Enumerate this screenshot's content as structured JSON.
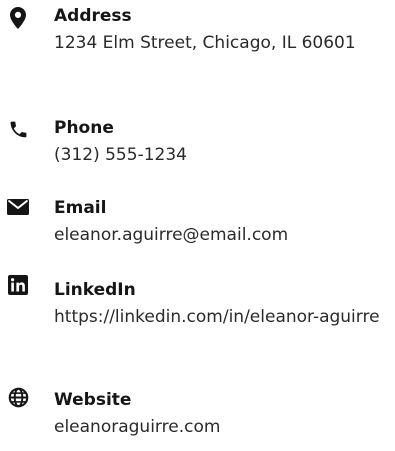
{
  "contacts": [
    {
      "label": "Address",
      "value": "1234 Elm Street, Chicago, IL 60601",
      "icon": "map-marker-icon"
    },
    {
      "label": "Phone",
      "value": "(312) 555-1234",
      "icon": "phone-icon"
    },
    {
      "label": "Email",
      "value": "eleanor.aguirre@email.com",
      "icon": "envelope-icon"
    },
    {
      "label": "LinkedIn",
      "value": "https://linkedin.com/in/eleanor-aguirre",
      "icon": "linkedin-icon"
    },
    {
      "label": "Website",
      "value": "eleanoraguirre.com",
      "icon": "globe-icon"
    }
  ],
  "colors": {
    "text": "#1f1f1f",
    "icon": "#151515"
  }
}
